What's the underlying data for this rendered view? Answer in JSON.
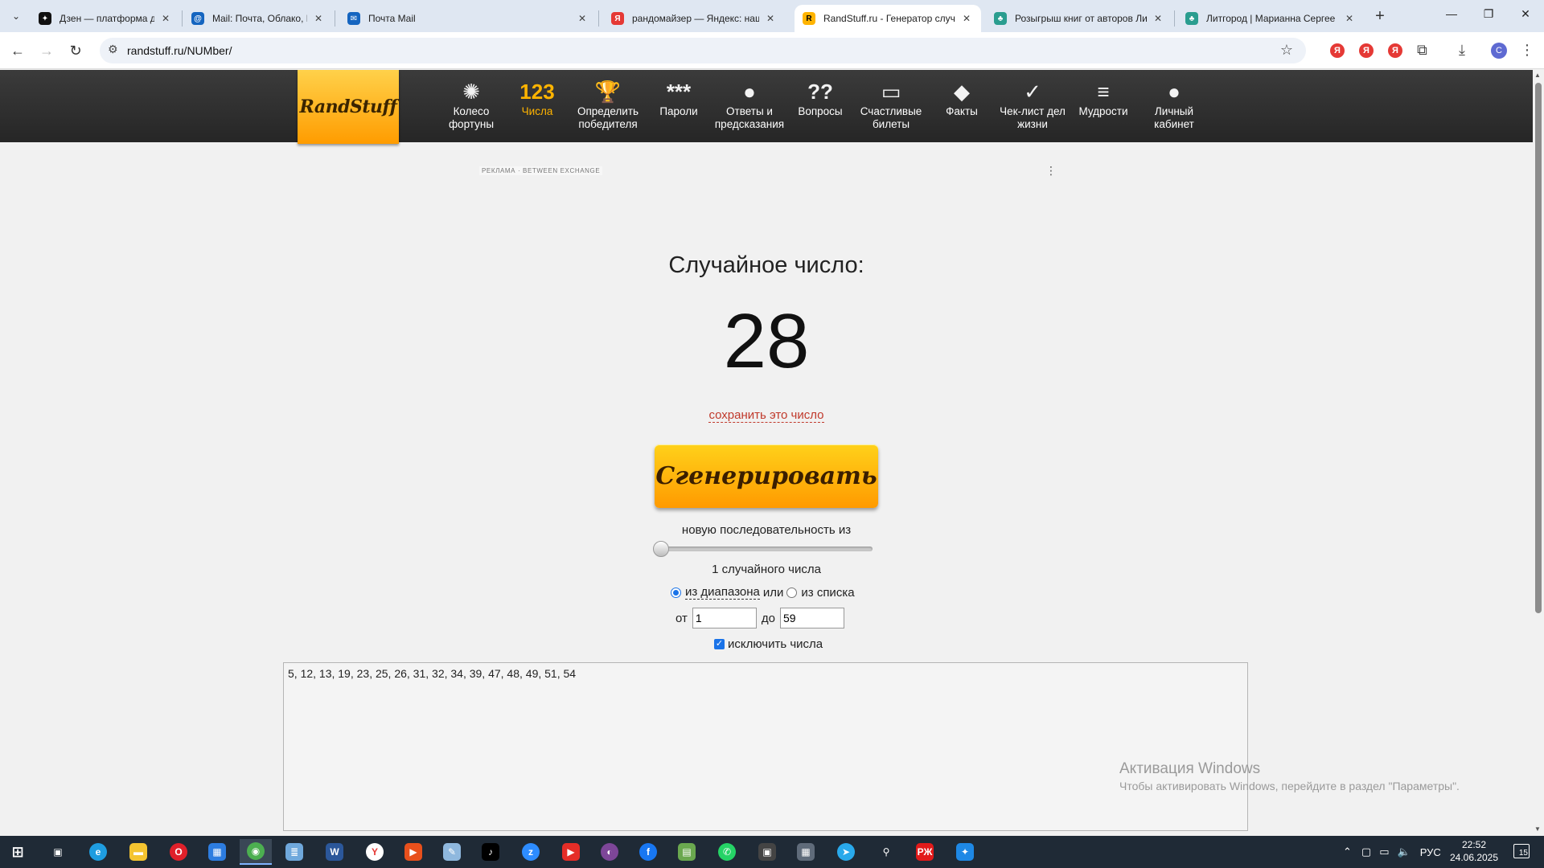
{
  "browser": {
    "tabs": [
      {
        "title": "Дзен — платформа для прос",
        "favicon": "dzen",
        "color": "#111111"
      },
      {
        "title": "Mail: Почта, Облако, Календар",
        "favicon": "mail-at",
        "color": "#1565c0"
      },
      {
        "title": "Почта Mail",
        "favicon": "mail-envelope",
        "color": "#1565c0"
      },
      {
        "title": "рандомайзер — Яндекс: нашл",
        "favicon": "yandex",
        "color": "#e53935"
      },
      {
        "title": "RandStuff.ru - Генератор случа",
        "favicon": "randstuff",
        "color": "#ffb400"
      },
      {
        "title": "Розыгрыш книг от авторов Ли",
        "favicon": "litgorod",
        "color": "#2a9d8f"
      },
      {
        "title": "Литгород | Марианна Сергее",
        "favicon": "litgorod",
        "color": "#2a9d8f"
      }
    ],
    "url": "randstuff.ru/NUMber/",
    "profile_initial": "С",
    "extensions": [
      "Я",
      "Я",
      "Я"
    ]
  },
  "site": {
    "logo": "RandStuff",
    "menu": [
      {
        "label": "Колесо фортуны",
        "icon": "wheel-icon",
        "glyph": "✺"
      },
      {
        "label": "Числа",
        "icon": "numbers-icon",
        "glyph": "123",
        "active": true
      },
      {
        "label": "Определить победителя",
        "icon": "trophy-icon",
        "glyph": "🏆"
      },
      {
        "label": "Пароли",
        "icon": "password-icon",
        "glyph": "***"
      },
      {
        "label": "Ответы и предсказания",
        "icon": "magic-ball-icon",
        "glyph": "●"
      },
      {
        "label": "Вопросы",
        "icon": "question-icon",
        "glyph": "??"
      },
      {
        "label": "Счастливые билеты",
        "icon": "ticket-icon",
        "glyph": "▭"
      },
      {
        "label": "Факты",
        "icon": "fact-icon",
        "glyph": "◆"
      },
      {
        "label": "Чек-лист дел жизни",
        "icon": "checklist-icon",
        "glyph": "✓"
      },
      {
        "label": "Мудрости",
        "icon": "scroll-icon",
        "glyph": "≡"
      },
      {
        "label": "Личный кабинет",
        "icon": "user-icon",
        "glyph": "●"
      }
    ]
  },
  "ad": {
    "label": "РЕКЛАМА · BETWEEN EXCHANGE"
  },
  "generator": {
    "title": "Случайное число:",
    "result": "28",
    "save_link": "сохранить это число",
    "button": "Сгенерировать",
    "sequence_label": "новую последовательность из",
    "slider_value": 1,
    "count_label": "1 случайного числа",
    "mode_range": "из диапазона",
    "mode_or": "или",
    "mode_list": "из списка",
    "from_label": "от",
    "from_value": "1",
    "to_label": "до",
    "to_value": "59",
    "exclude_label": "исключить числа",
    "exclude_checked": true,
    "excluded_numbers": "5, 12, 13, 19, 23, 25, 26, 31, 32, 34, 39, 47, 48, 49, 51, 54"
  },
  "watermark": {
    "title": "Активация Windows",
    "subtitle": "Чтобы активировать Windows, перейдите в раздел \"Параметры\"."
  },
  "taskbar": {
    "language": "РУС",
    "time": "22:52",
    "date": "24.06.2025",
    "notifications": "15"
  }
}
